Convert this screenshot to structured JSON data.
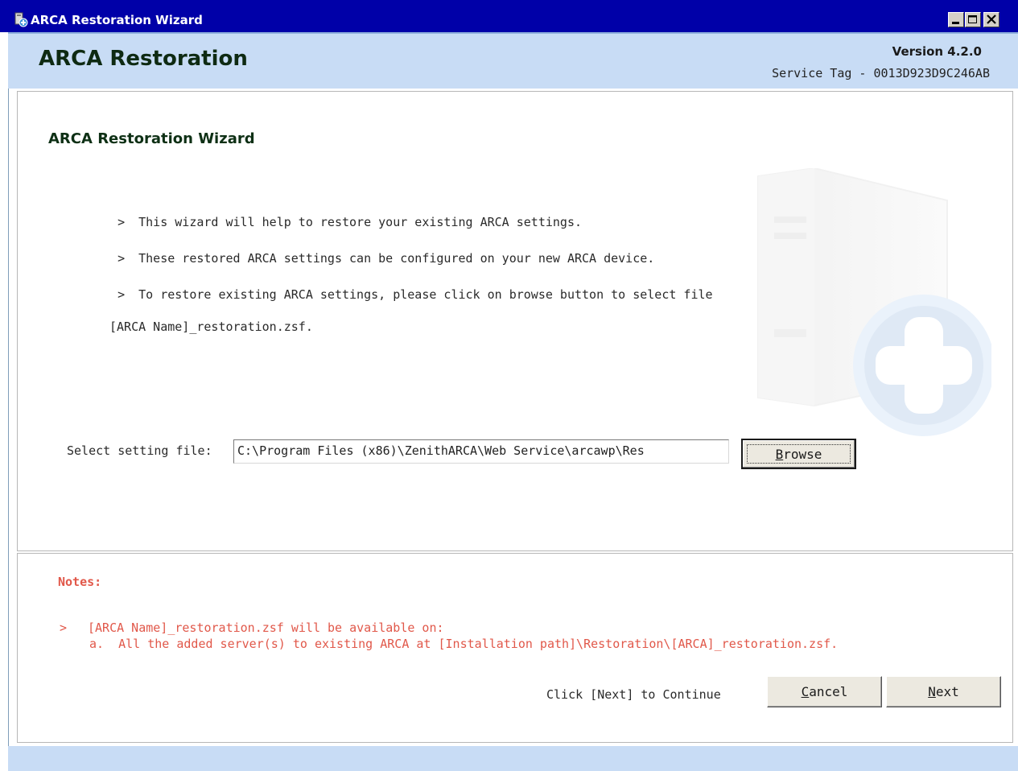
{
  "window": {
    "title": "ARCA Restoration Wizard"
  },
  "header": {
    "app_title": "ARCA Restoration",
    "version": "Version 4.2.0",
    "service_tag": "Service Tag - 0013D923D9C246AB"
  },
  "main": {
    "heading": "ARCA Restoration Wizard",
    "bullets": [
      {
        "arrow": ">",
        "text": "This wizard will help to restore your existing ARCA settings."
      },
      {
        "arrow": ">",
        "text": "These restored ARCA settings can be configured on your new ARCA device."
      },
      {
        "arrow": ">",
        "text": "To restore existing ARCA settings, please click on browse button to select file",
        "continuation": "[ARCA Name]_restoration.zsf."
      }
    ],
    "select_label": "Select setting file:",
    "file_value": "C:\\Program Files (x86)\\ZenithARCA\\Web Service\\arcawp\\Res",
    "browse": {
      "mnemonic": "B",
      "rest": "rowse"
    }
  },
  "notes": {
    "title": "Notes:",
    "arrow": ">",
    "line": "[ARCA Name]_restoration.zsf will be available on:",
    "sub": "a.  All the added server(s) to existing ARCA at [Installation path]\\Restoration\\[ARCA]_restoration.zsf."
  },
  "footer": {
    "continue_text": "Click [Next] to Continue",
    "cancel": {
      "mnemonic": "C",
      "rest": "ancel"
    },
    "next": {
      "mnemonic": "N",
      "rest": "ext"
    }
  },
  "colors": {
    "titlebar": "#0000a8",
    "header_band": "#c8dcf5",
    "notes_text": "#e1584a",
    "heading_text": "#0e3015"
  },
  "icons": {
    "app": "wizard-app-icon",
    "minimize": "minimize-icon",
    "maximize": "maximize-icon",
    "close": "close-icon",
    "watermark": "server-add-icon"
  }
}
